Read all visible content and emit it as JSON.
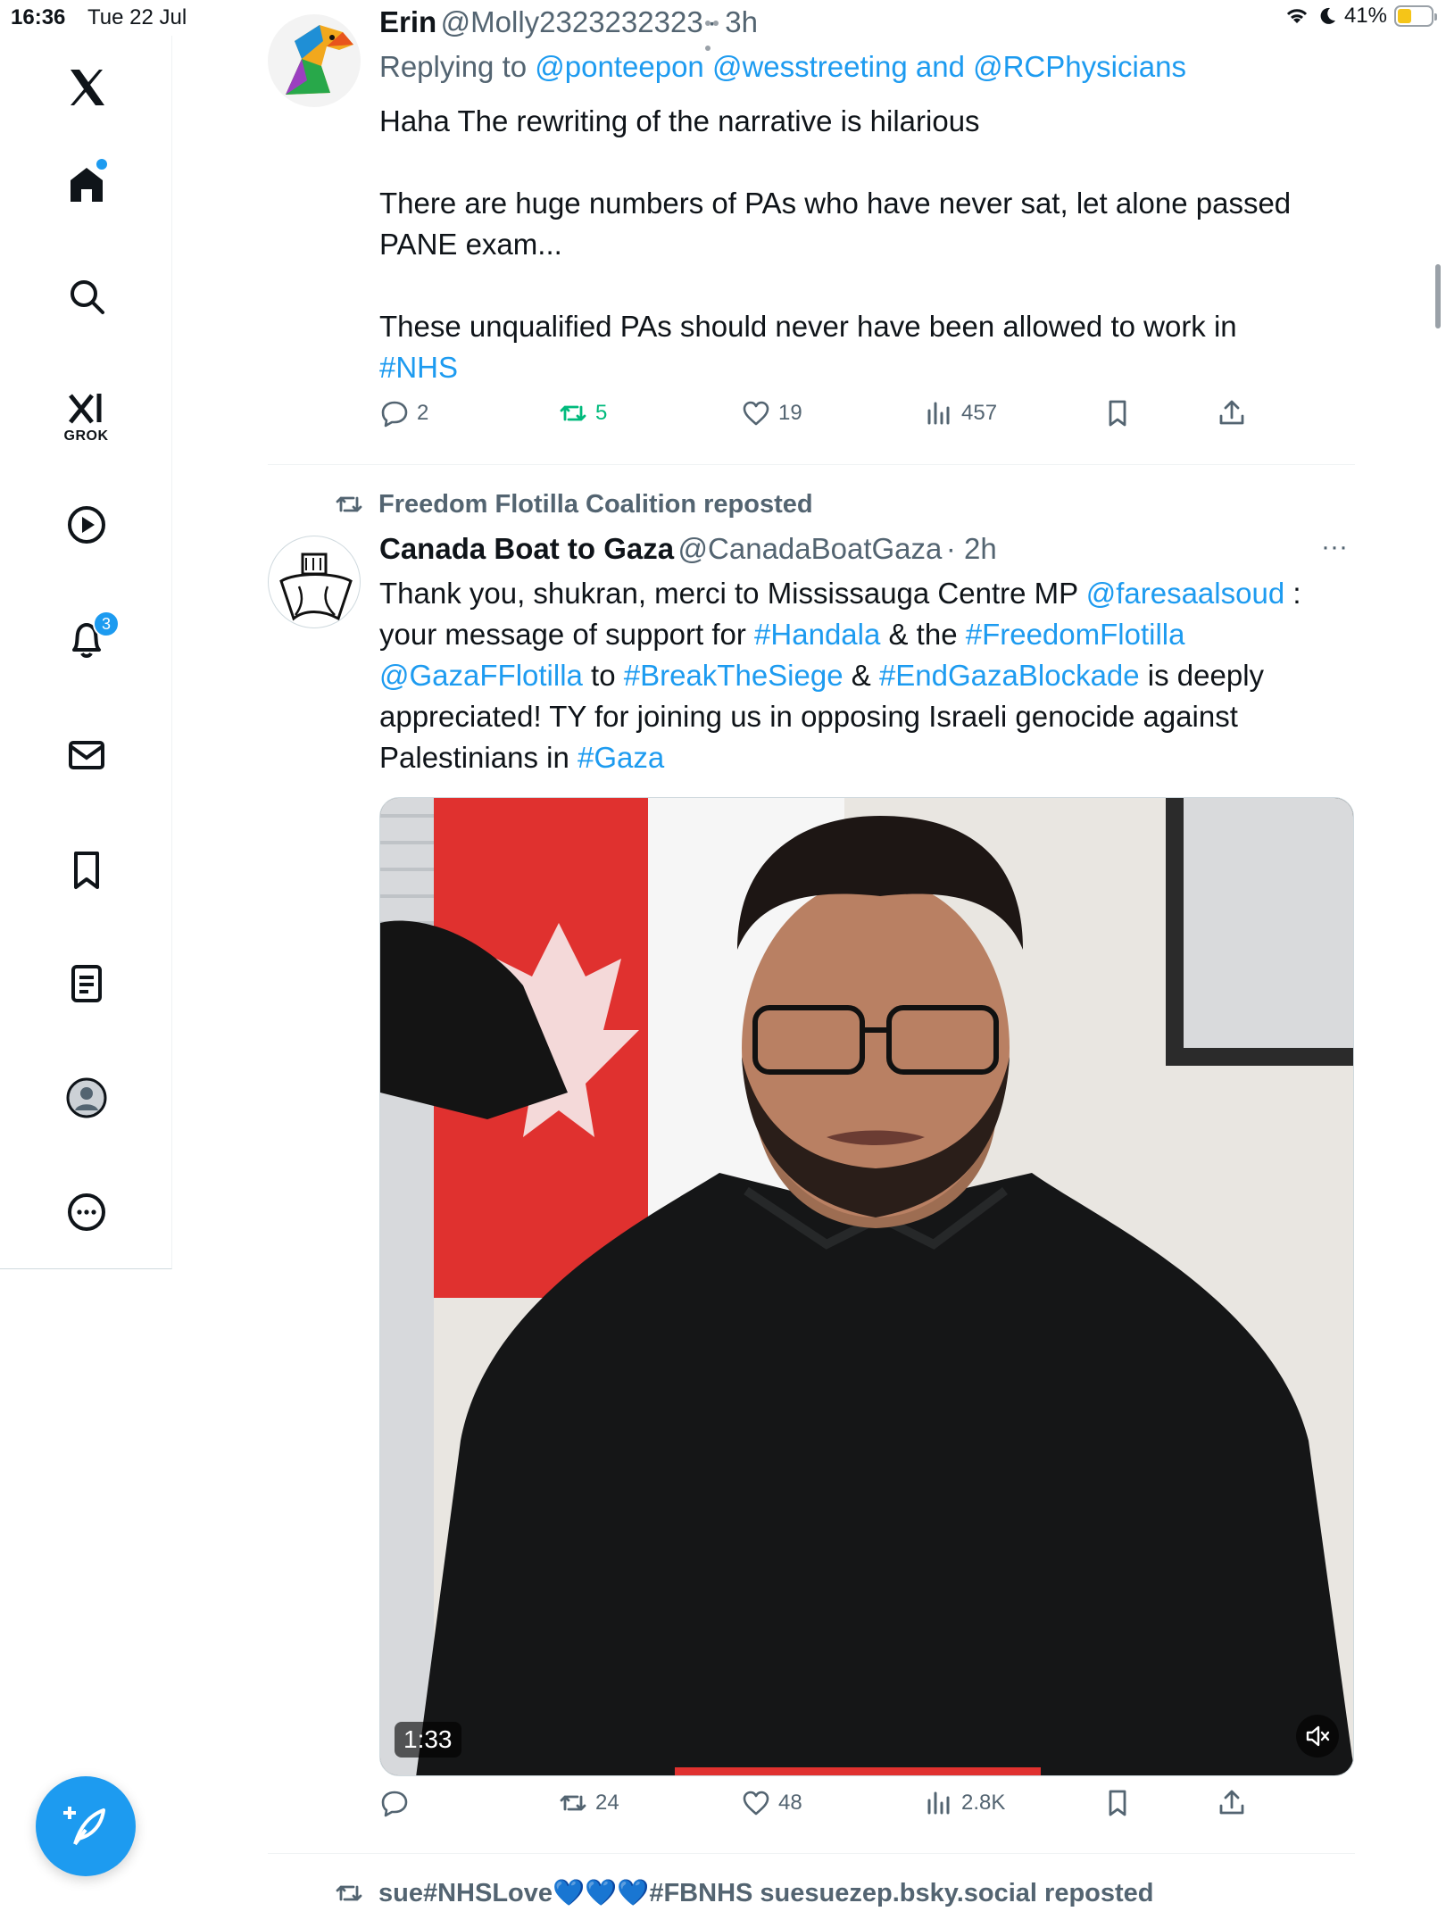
{
  "status_bar": {
    "time": "16:36",
    "date": "Tue 22 Jul",
    "battery": "41%",
    "battery_level": 0.41
  },
  "sidebar": {
    "grok_label": "GROK",
    "notifications_badge": "3",
    "items": [
      "x-logo",
      "home",
      "explore",
      "grok",
      "video",
      "notifications",
      "messages",
      "bookmarks",
      "lists",
      "profile",
      "more"
    ]
  },
  "tweet1": {
    "name": "Erin",
    "handle": "@Molly2323232323",
    "time": "· 3h",
    "reply_prefix": "Replying to",
    "reply_mentions": "@ponteepon @wesstreeting and @RCPhysicians",
    "line1": "Haha The rewriting of the narrative is hilarious",
    "line2": "There are huge numbers of PAs who have never sat, let alone passed PANE exam...",
    "line3": "These unqualified  PAs should never have been allowed to work in",
    "hashtag": "#NHS",
    "replies": "2",
    "reposts": "5",
    "likes": "19",
    "views": "457"
  },
  "tweet2": {
    "social_context": "Freedom Flotilla Coalition reposted",
    "name": "Canada Boat to Gaza",
    "handle": "@CanadaBoatGaza",
    "time": "· 2h",
    "more": "···",
    "t1": "Thank you, shukran, merci to Mississauga Centre MP ",
    "m1": "@faresaalsoud",
    "t2": " :",
    "t3": "your message of support for ",
    "h1": "#Handala",
    "t4": " & the ",
    "h2": "#FreedomFlotilla",
    "m2": "@GazaFFlotilla",
    "t5": " to ",
    "h3": "#BreakTheSiege",
    "t6": " & ",
    "h4": "#EndGazaBlockade",
    "t7": " is deeply",
    "t8": "appreciated! TY for joining us in opposing Israeli genocide against",
    "t9": "Palestinians in ",
    "h5": "#Gaza",
    "video_duration": "1:33",
    "replies": "",
    "reposts": "24",
    "likes": "48",
    "views": "2.8K"
  },
  "tweet3": {
    "social_context": "sue#NHSLove💙💙💙#FBNHS suesuezep.bsky.social reposted"
  }
}
